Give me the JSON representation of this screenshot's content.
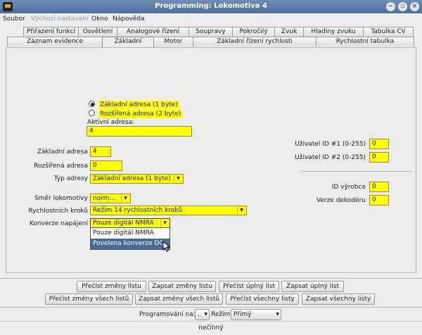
{
  "window": {
    "title": "Programming: Lokomotiva 4"
  },
  "menu": [
    "Soubor",
    "Výchozí nastavení",
    "Okno",
    "Nápověda"
  ],
  "tabs_row1": [
    "Přiřazení funkcí",
    "Osvětlení",
    "Analogové řízení",
    "Soupravy",
    "Pokročilý",
    "Zvuk",
    "Hladiny zvuku",
    "Tabulka CV"
  ],
  "tabs_row2": [
    "Záznam evidence",
    "Základní",
    "Motor",
    "Základní řízení rychlosti",
    "Rychlostní tabulka"
  ],
  "selected_tab": "Základní",
  "address": {
    "radio_basic": "Základní adresa (1 byte)",
    "radio_extended": "Rozšířená adresa (2 byte)",
    "active_label": "Aktivní adresa:",
    "active_value": "4"
  },
  "fields": {
    "basic_label": "Základní adresa",
    "basic_value": "4",
    "extended_label": "Rozšířená adresa",
    "extended_value": "0",
    "type_label": "Typ adresy",
    "type_value": "Základní adresa (1 byte)",
    "direction_label": "Směr lokomotivy",
    "direction_value": "norm...",
    "speed_steps_label": "Rychlostních kroků",
    "speed_steps_value": "Režim 14 rychlostních kroků",
    "power_label": "Konverze napájení",
    "power_value": "Pouze digitál NMRA",
    "power_options": [
      "Pouze digitál NMRA",
      "Povolena konverze DC"
    ]
  },
  "right": {
    "uid1_label": "Uživatel ID #1 (0-255)",
    "uid1_value": "0",
    "uid2_label": "Uživatel ID #2 (0-255)",
    "uid2_value": "0",
    "mfg_label": "ID výrobce",
    "mfg_value": "0",
    "ver_label": "Verze dekodéru",
    "ver_value": "0"
  },
  "buttons_row1": [
    "Přečíst změny listu",
    "Zapsat změny listu",
    "Přečíst úplný list",
    "Zapsat úplný list"
  ],
  "buttons_row2": [
    "Přečíst změny všech listů",
    "Zapsat změny všech listů",
    "Přečíst všechny listy",
    "Zapsat všechny listy"
  ],
  "programming": {
    "label": "Programování na:",
    "value": ".",
    "mode_label": "Režim:",
    "mode_value": "Přímý"
  },
  "status": "nečinný"
}
